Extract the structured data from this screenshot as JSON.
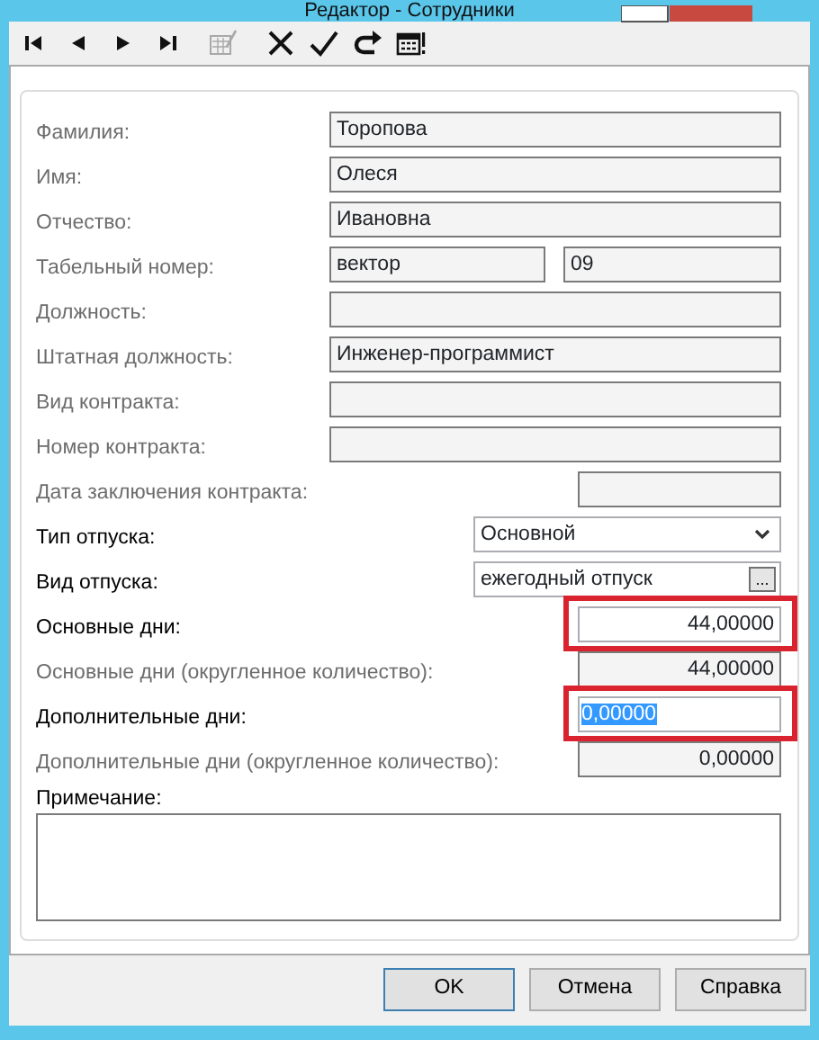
{
  "window": {
    "title": "Редактор - Сотрудники"
  },
  "toolbar": [
    {
      "kind": "first",
      "disabled": false
    },
    {
      "kind": "prev",
      "disabled": false
    },
    {
      "kind": "next",
      "disabled": false
    },
    {
      "kind": "last",
      "disabled": false
    },
    {
      "kind": "edit",
      "disabled": true
    },
    {
      "kind": "delete",
      "disabled": false
    },
    {
      "kind": "apply",
      "disabled": false
    },
    {
      "kind": "redo",
      "disabled": false
    },
    {
      "kind": "calendar",
      "disabled": false
    }
  ],
  "fields": [
    {
      "kind": "text",
      "label": "Фамилия:",
      "value": "Торопова",
      "disabled": true
    },
    {
      "kind": "text",
      "label": "Имя:",
      "value": "Олеся",
      "disabled": true
    },
    {
      "kind": "text",
      "label": "Отчество:",
      "value": "Ивановна",
      "disabled": true
    },
    {
      "kind": "pair",
      "label": "Табельный номер:",
      "value": "вектор",
      "value_2": "09",
      "disabled": true
    },
    {
      "kind": "text",
      "label": "Должность:",
      "disabled": true
    },
    {
      "kind": "text",
      "label": "Штатная должность:",
      "value": "Инженер-программист",
      "disabled": true
    },
    {
      "kind": "text",
      "label": "Вид контракта:",
      "disabled": true
    },
    {
      "kind": "text",
      "label": "Номер контракта:",
      "disabled": true
    },
    {
      "kind": "short",
      "label": "Дата заключения контракта:",
      "disabled": true
    },
    {
      "kind": "select",
      "label": "Тип отпуска:",
      "value": "Основной",
      "disabled": false
    },
    {
      "kind": "lookup",
      "label": "Вид отпуска:",
      "value": "ежегодный отпуск",
      "button": "...",
      "disabled": false
    },
    {
      "kind": "number",
      "label": "Основные дни:",
      "value": "44,00000",
      "disabled": false,
      "highlighted": true,
      "text_selected": false
    },
    {
      "kind": "number",
      "label": "Основные дни (округленное количество):",
      "value": "44,00000",
      "disabled": true
    },
    {
      "kind": "number",
      "label": "Дополнительные дни:",
      "value": "0,00000",
      "disabled": false,
      "highlighted": true,
      "text_selected": true
    },
    {
      "kind": "number",
      "label": "Дополнительные дни (округленное количество):",
      "value": "0,00000",
      "disabled": true
    }
  ],
  "note": {
    "label": "Примечание:"
  },
  "buttons": [
    {
      "label": "OK",
      "default": true
    },
    {
      "label": "Отмена",
      "default": false
    },
    {
      "label": "Справка",
      "default": false
    }
  ]
}
